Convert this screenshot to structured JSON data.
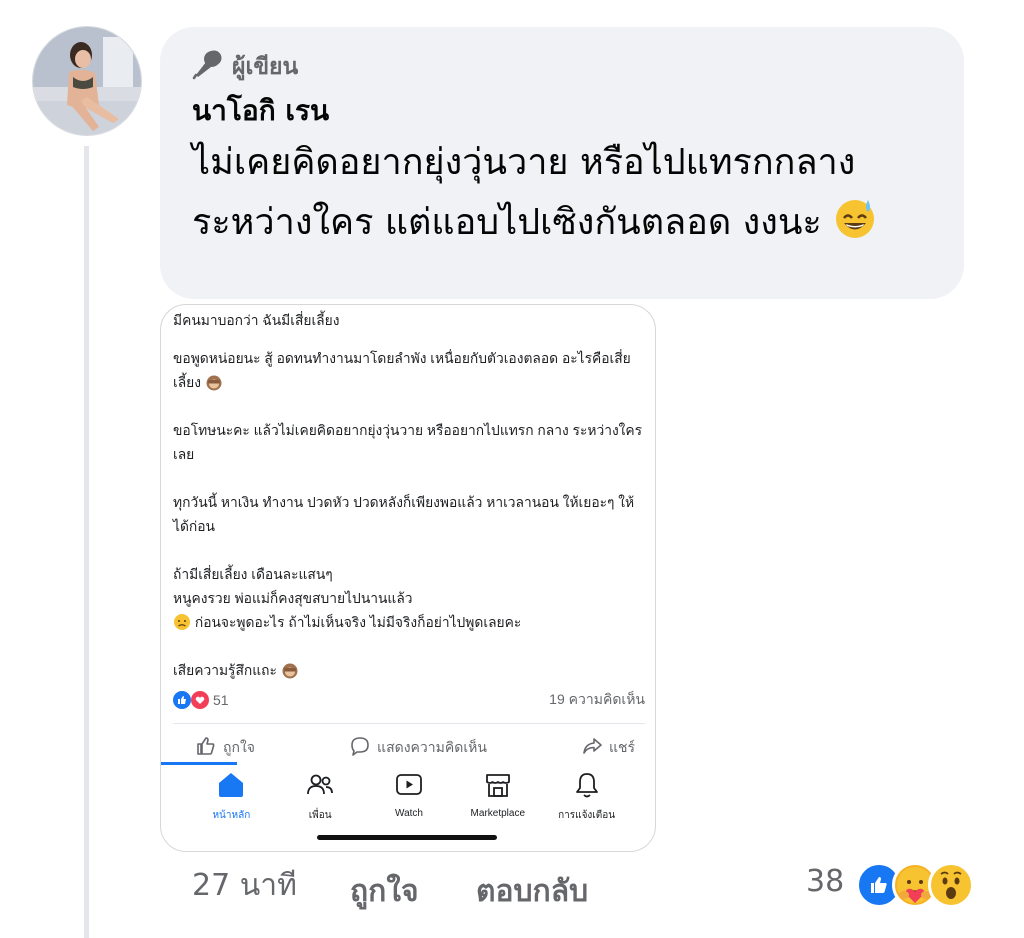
{
  "comment": {
    "author_badge": "ผู้เขียน",
    "author_name": "นาโอกิ เรน",
    "text_line1": "ไม่เคยคิดอยากยุ่งวุ่นวาย หรือไปแทรกกลาง",
    "text_line2": "ระหว่างใคร แต่แอบไปเซิงกันตลอด งงนะ",
    "time": "27 นาที",
    "like_label": "ถูกใจ",
    "reply_label": "ตอบกลับ",
    "reaction_count": "38",
    "reactions": [
      "like-icon",
      "care-icon",
      "wow-icon"
    ]
  },
  "screenshot": {
    "post_paragraphs": [
      "มีคนมาบอกว่า ฉันมีเสี่ยเลี้ยง",
      "ขอพูดหน่อยนะ สู้ อดทนทำงานมาโดยลำพัง เหนื่อยกับตัวเองตลอด อะไรคือเสี่ยเลี้ยง",
      "ขอโทษนะคะ แล้วไม่เคยคิดอยากยุ่งวุ่นวาย หรืออยากไปแทรก กลาง ระหว่างใครเลย",
      "ทุกวันนี้ หาเงิน ทำงาน ปวดหัว ปวดหลังก็เพียงพอแล้ว หาเวลานอน ให้เยอะๆ ให้ได้ก่อน",
      "ถ้ามีเสี่ยเลี้ยง เดือนละแสนๆ",
      "หนูคงรวย พ่อแม่ก็คงสุขสบายไปนานแล้ว",
      "ก่อนจะพูดอะไร ถ้าไม่เห็นจริง ไม่มีจริงก็อย่าไปพูดเลยคะ",
      "เสียความรู้สึกแถะ"
    ],
    "reaction_count": "51",
    "comment_count": "19 ความคิดเห็น",
    "actions": {
      "like": "ถูกใจ",
      "comment": "แสดงความคิดเห็น",
      "share": "แชร์"
    },
    "tabs": [
      {
        "label": "หน้าหลัก",
        "icon": "home-icon"
      },
      {
        "label": "เพื่อน",
        "icon": "friends-icon"
      },
      {
        "label": "Watch",
        "icon": "watch-icon"
      },
      {
        "label": "Marketplace",
        "icon": "marketplace-icon"
      },
      {
        "label": "การแจ้งเตือน",
        "icon": "bell-icon"
      }
    ]
  },
  "colors": {
    "fb_blue": "#1877f2",
    "bubble_bg": "#f0f2f5",
    "secondary_text": "#65676b",
    "love_red": "#f33e58",
    "wow_yellow": "#f7b125"
  }
}
